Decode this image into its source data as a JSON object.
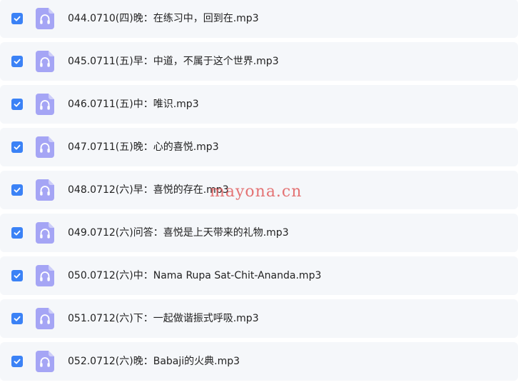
{
  "theme": {
    "checkbox_color": "#3b82f6",
    "audio_icon_color": "#a5a5f5",
    "row_background": "#f5f7fa",
    "watermark_color": "#e05c5c"
  },
  "files": [
    {
      "name": "044.0710(四)晚：在练习中，回到在.mp3",
      "checked": true,
      "icon": "headphones-icon"
    },
    {
      "name": "045.0711(五)早：中道，不属于这个世界.mp3",
      "checked": true,
      "icon": "headphones-icon"
    },
    {
      "name": "046.0711(五)中：唯识.mp3",
      "checked": true,
      "icon": "headphones-icon"
    },
    {
      "name": "047.0711(五)晚：心的喜悦.mp3",
      "checked": true,
      "icon": "headphones-icon"
    },
    {
      "name": "048.0712(六)早：喜悦的存在.mp3",
      "checked": true,
      "icon": "headphones-icon"
    },
    {
      "name": "049.0712(六)问答：喜悦是上天带来的礼物.mp3",
      "checked": true,
      "icon": "headphones-icon"
    },
    {
      "name": "050.0712(六)中：Nama Rupa Sat-Chit-Ananda.mp3",
      "checked": true,
      "icon": "headphones-icon"
    },
    {
      "name": "051.0712(六)下：一起做谐振式呼吸.mp3",
      "checked": true,
      "icon": "headphones-icon"
    },
    {
      "name": "052.0712(六)晚：Babaji的火典.mp3",
      "checked": true,
      "icon": "headphones-icon"
    }
  ],
  "watermark": "mayona.cn"
}
